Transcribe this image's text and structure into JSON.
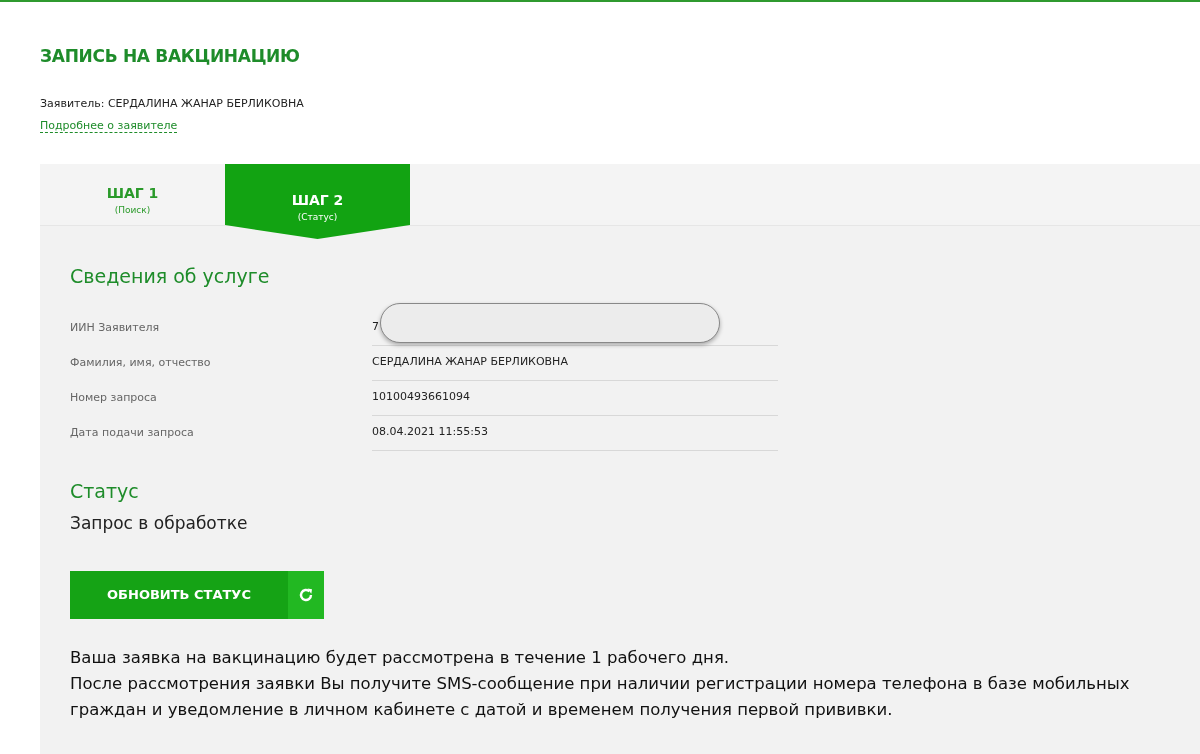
{
  "page": {
    "title": "ЗАПИСЬ НА ВАКЦИНАЦИЮ",
    "applicant": "Заявитель: СЕРДАЛИНА ЖАНАР БЕРЛИКОВНА",
    "applicant_link": "Подробнее о заявителе"
  },
  "steps": [
    {
      "label": "ШАГ 1",
      "caption": "(Поиск)",
      "selected": false
    },
    {
      "label": "ШАГ 2",
      "caption": "(Статус)",
      "selected": true
    }
  ],
  "service": {
    "heading": "Сведения об услуге",
    "rows": [
      {
        "label": "ИИН Заявителя",
        "value": "7",
        "redacted": true
      },
      {
        "label": "Фамилия, имя, отчество",
        "value": "СЕРДАЛИНА ЖАНАР БЕРЛИКОВНА",
        "redacted": false
      },
      {
        "label": "Номер запроса",
        "value": "10100493661094",
        "redacted": false
      },
      {
        "label": "Дата подачи запроса",
        "value": "08.04.2021 11:55:53",
        "redacted": false
      }
    ]
  },
  "status": {
    "heading": "Статус",
    "value": "Запрос в обработке",
    "button": "ОБНОВИТЬ СТАТУС"
  },
  "notes": [
    "Ваша заявка на вакцинацию будет рассмотрена в течение 1 рабочего дня.",
    "После рассмотрения заявки Вы получите SMS-сообщение при наличии регистрации номера телефона в базе мобильных граждан и уведомление в личном кабинете с датой и временем получения первой прививки."
  ]
}
